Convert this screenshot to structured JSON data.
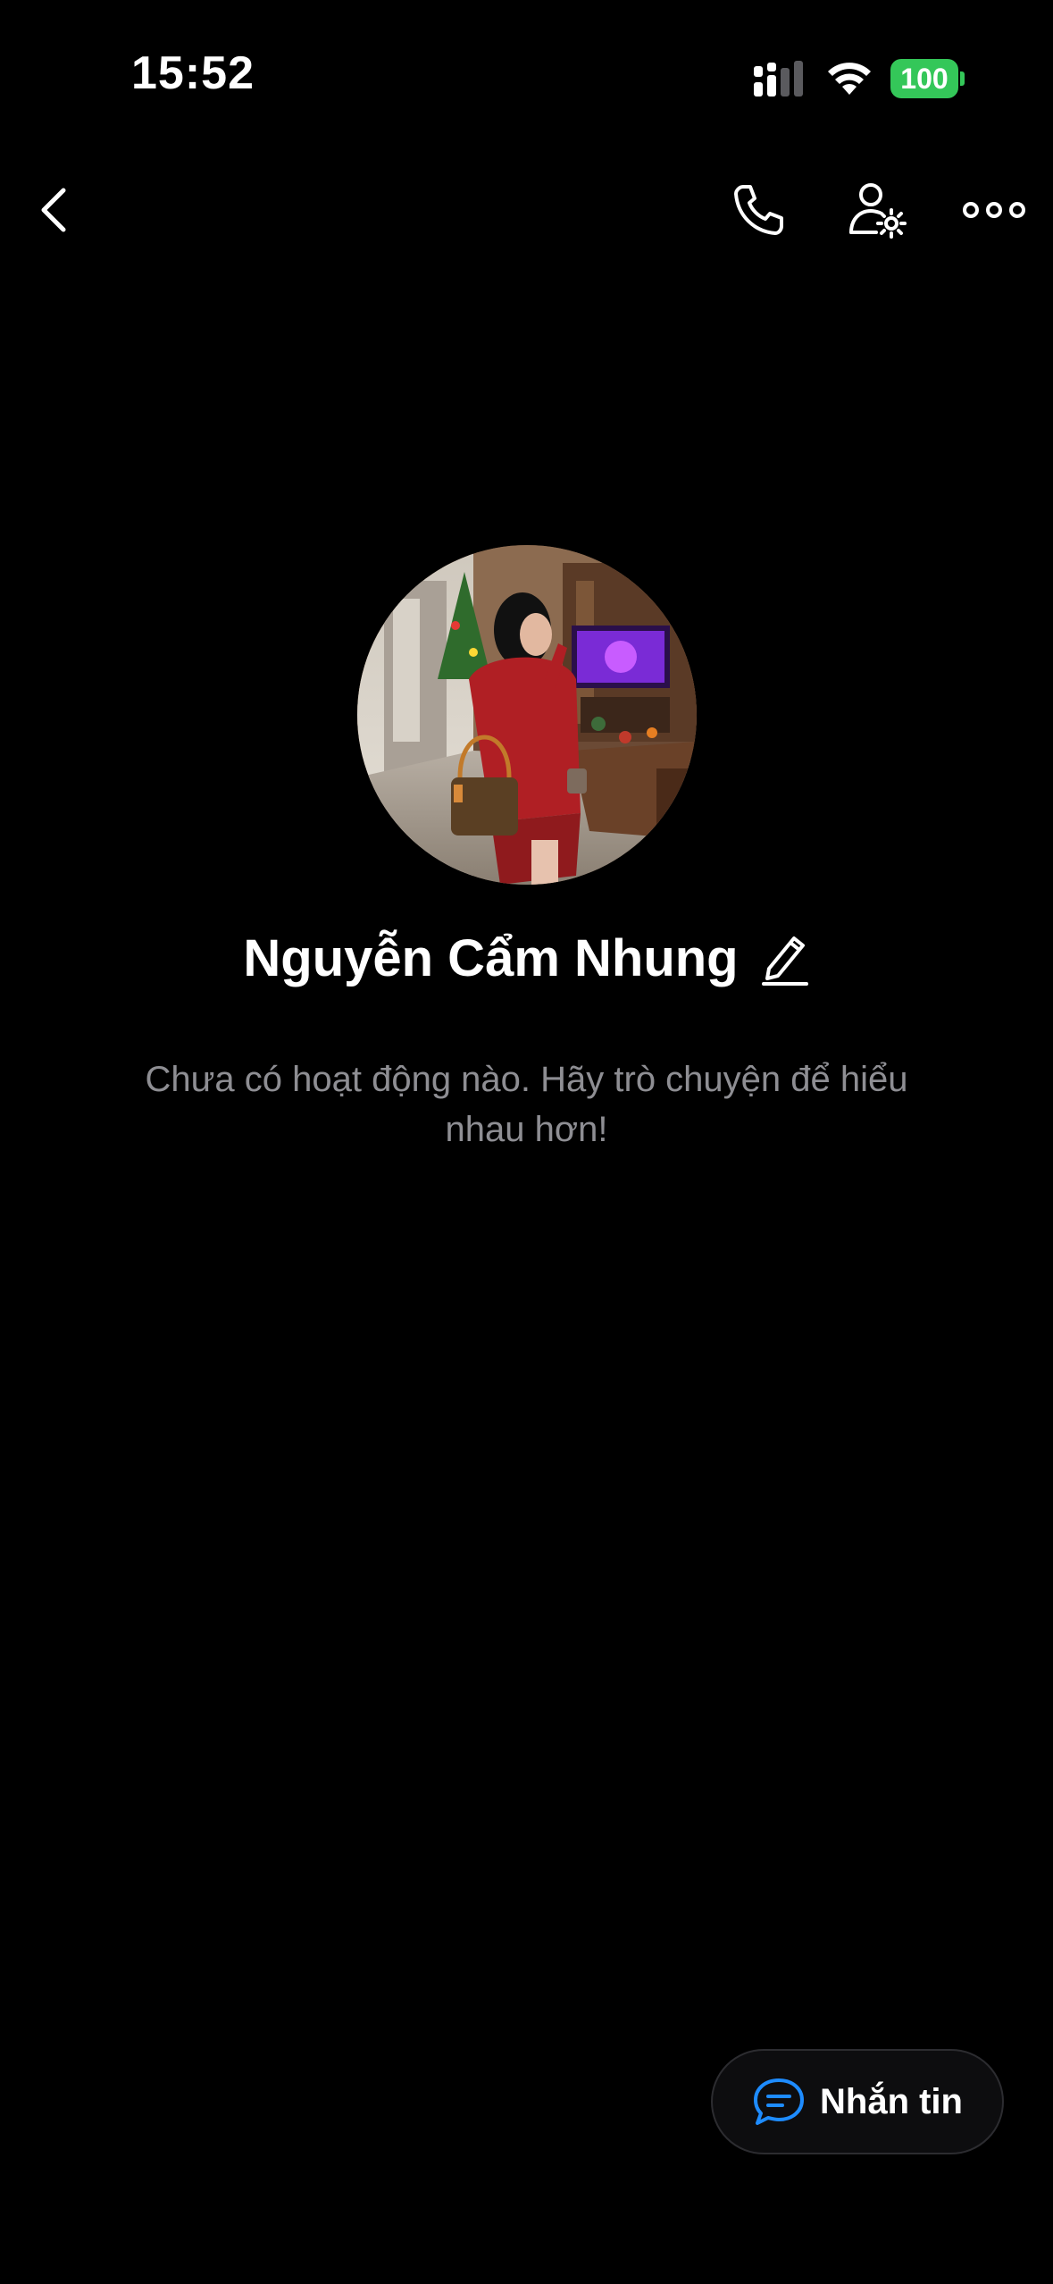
{
  "status_bar": {
    "time": "15:52",
    "battery": "100",
    "battery_color": "#34c759"
  },
  "nav": {
    "back_icon": "chevron-left-icon",
    "call_icon": "phone-icon",
    "settings_icon": "user-settings-icon",
    "more_icon": "more-horizontal-icon"
  },
  "profile": {
    "name": "Nguyễn Cẩm Nhung",
    "edit_icon": "pencil-icon",
    "activity_text": "Chưa có hoạt động nào. Hãy trò chuyện để hiểu nhau hơn!"
  },
  "message_button": {
    "label": "Nhắn tin",
    "icon": "chat-bubble-icon",
    "accent": "#1e8cff"
  }
}
